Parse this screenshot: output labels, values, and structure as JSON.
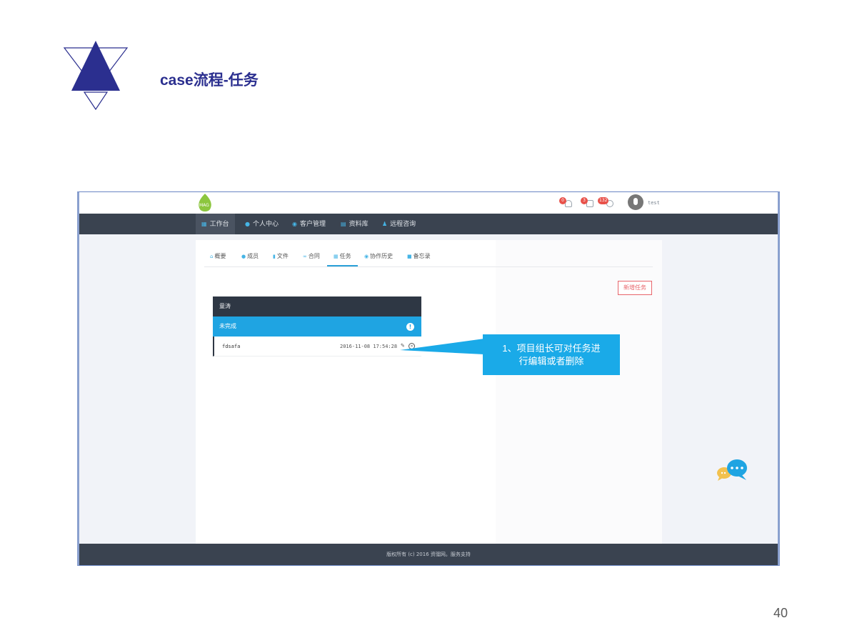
{
  "slide": {
    "title": "case流程-任务",
    "page_number": "40"
  },
  "app": {
    "logo_text": "MAG",
    "notifications": [
      {
        "icon": "bell-icon",
        "count": "0"
      },
      {
        "icon": "message-icon",
        "count": "3"
      },
      {
        "icon": "mail-icon",
        "count": "132"
      }
    ],
    "username": "test",
    "nav": [
      {
        "icon": "grid-icon",
        "label": "工作台"
      },
      {
        "icon": "user-icon",
        "label": "个人中心"
      },
      {
        "icon": "chat-icon",
        "label": "客户管理"
      },
      {
        "icon": "database-icon",
        "label": "资料库"
      },
      {
        "icon": "person-icon",
        "label": "远程咨询"
      }
    ],
    "tabs": [
      {
        "icon": "home-icon",
        "label": "概要"
      },
      {
        "icon": "user-icon",
        "label": "成员"
      },
      {
        "icon": "file-icon",
        "label": "文件"
      },
      {
        "icon": "link-icon",
        "label": "合同"
      },
      {
        "icon": "calendar-icon",
        "label": "任务"
      },
      {
        "icon": "comments-icon",
        "label": "协作历史"
      },
      {
        "icon": "note-icon",
        "label": "备忘录"
      }
    ],
    "new_task_button": "新增任务",
    "task_group": {
      "owner": "童涛",
      "status": "未完成",
      "tasks": [
        {
          "name": "fdsafa",
          "time": "2016-11-08 17:54:28"
        }
      ]
    },
    "footer": "版权所有 (c) 2016 资骝网。服务支持"
  },
  "callout": {
    "line1": "1、项目组长可对任务进",
    "line2": "行编辑或者删除"
  },
  "colors": {
    "title": "#2b2f8f",
    "nav_bg": "#3a4350",
    "accent_blue": "#1fa4e2",
    "callout": "#1aaae8",
    "new_task_border": "#e8656b"
  }
}
